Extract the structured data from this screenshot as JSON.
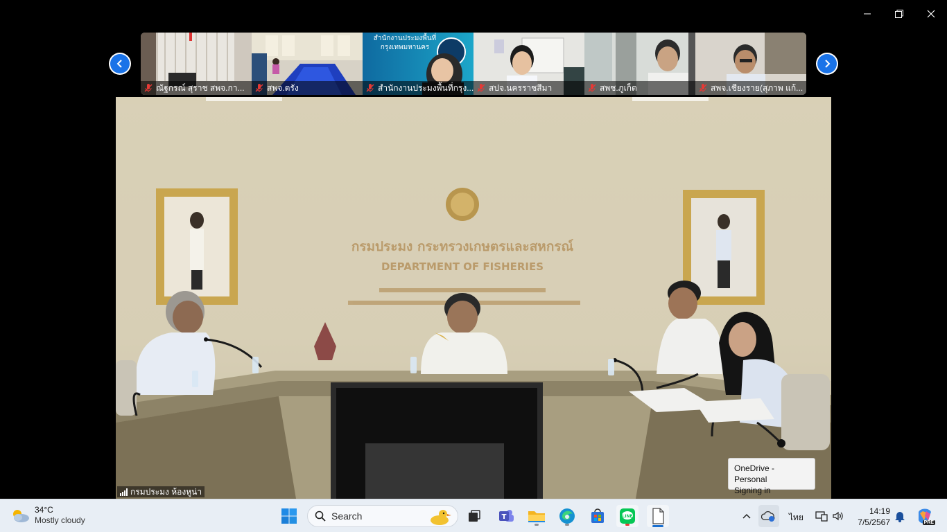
{
  "meeting": {
    "participants": [
      {
        "name": "ณัฐกรณ์  สุราช  สพจ.กา...",
        "muted": true
      },
      {
        "name": "สพจ.ตรัง",
        "muted": true
      },
      {
        "name": "สำนักงานประมงพื้นที่กรุง...",
        "muted": true,
        "overlay_text": "สำนักงานประมงพื้นที่\nกรุงเทพมหานคร"
      },
      {
        "name": "สปจ.นครราชสีมา",
        "muted": true
      },
      {
        "name": "สพช.ภูเก็ต",
        "muted": true
      },
      {
        "name": "สพจ.เชียงราย(สุภาพ  แก้...",
        "muted": true
      }
    ],
    "main_speaker_name": "กรมประมง ห้องหูน่า",
    "room_sign_th": "กรมประมง กระทรวงเกษตรและสหกรณ์",
    "room_sign_en": "DEPARTMENT OF FISHERIES"
  },
  "notification": {
    "title": "OneDrive - Personal",
    "body": "Signing in"
  },
  "taskbar": {
    "weather_temp": "34°C",
    "weather_desc": "Mostly cloudy",
    "search_label": "Search",
    "language": "ไทย",
    "time": "14:19",
    "date": "7/5/2567",
    "copilot_badge": "PRE"
  },
  "colors": {
    "accent": "#1a73e8",
    "taskbar_bg": "#e8eef5",
    "muted_icon": "#e53935"
  }
}
